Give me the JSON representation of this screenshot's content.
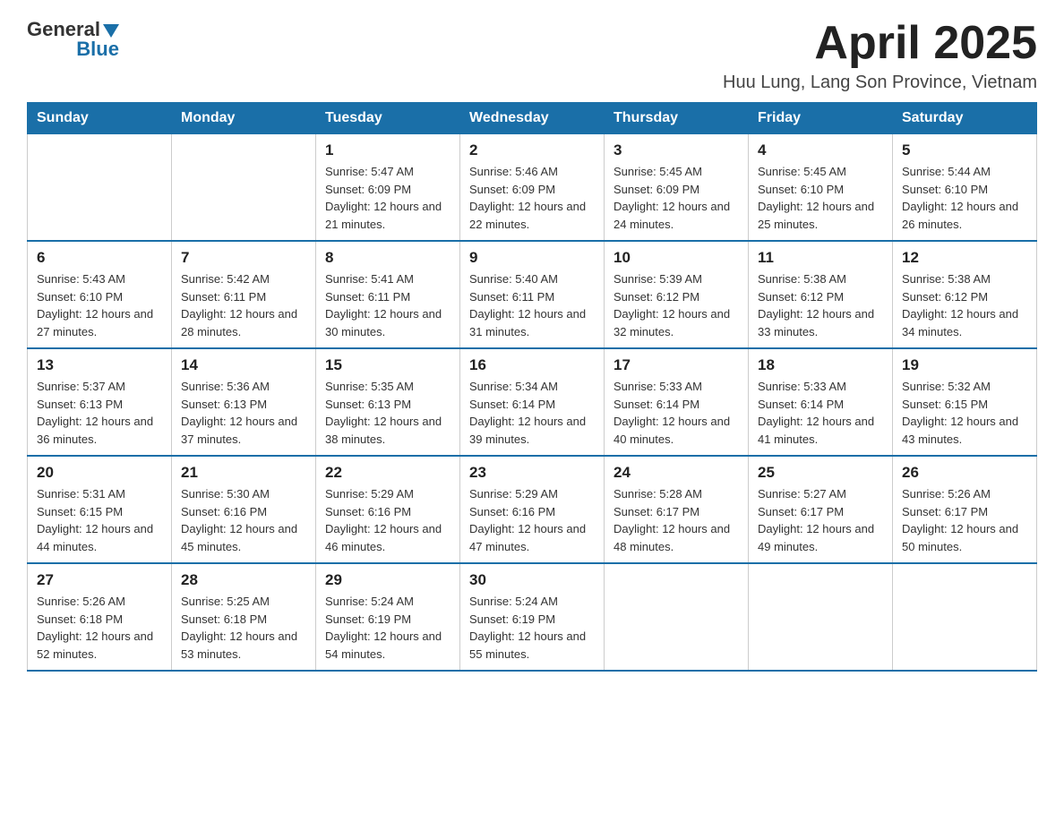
{
  "logo": {
    "text_general": "General",
    "text_blue": "Blue",
    "arrow": "▼"
  },
  "header": {
    "month_title": "April 2025",
    "location": "Huu Lung, Lang Son Province, Vietnam"
  },
  "days_of_week": [
    "Sunday",
    "Monday",
    "Tuesday",
    "Wednesday",
    "Thursday",
    "Friday",
    "Saturday"
  ],
  "weeks": [
    [
      {
        "day": "",
        "sunrise": "",
        "sunset": "",
        "daylight": ""
      },
      {
        "day": "",
        "sunrise": "",
        "sunset": "",
        "daylight": ""
      },
      {
        "day": "1",
        "sunrise": "Sunrise: 5:47 AM",
        "sunset": "Sunset: 6:09 PM",
        "daylight": "Daylight: 12 hours and 21 minutes."
      },
      {
        "day": "2",
        "sunrise": "Sunrise: 5:46 AM",
        "sunset": "Sunset: 6:09 PM",
        "daylight": "Daylight: 12 hours and 22 minutes."
      },
      {
        "day": "3",
        "sunrise": "Sunrise: 5:45 AM",
        "sunset": "Sunset: 6:09 PM",
        "daylight": "Daylight: 12 hours and 24 minutes."
      },
      {
        "day": "4",
        "sunrise": "Sunrise: 5:45 AM",
        "sunset": "Sunset: 6:10 PM",
        "daylight": "Daylight: 12 hours and 25 minutes."
      },
      {
        "day": "5",
        "sunrise": "Sunrise: 5:44 AM",
        "sunset": "Sunset: 6:10 PM",
        "daylight": "Daylight: 12 hours and 26 minutes."
      }
    ],
    [
      {
        "day": "6",
        "sunrise": "Sunrise: 5:43 AM",
        "sunset": "Sunset: 6:10 PM",
        "daylight": "Daylight: 12 hours and 27 minutes."
      },
      {
        "day": "7",
        "sunrise": "Sunrise: 5:42 AM",
        "sunset": "Sunset: 6:11 PM",
        "daylight": "Daylight: 12 hours and 28 minutes."
      },
      {
        "day": "8",
        "sunrise": "Sunrise: 5:41 AM",
        "sunset": "Sunset: 6:11 PM",
        "daylight": "Daylight: 12 hours and 30 minutes."
      },
      {
        "day": "9",
        "sunrise": "Sunrise: 5:40 AM",
        "sunset": "Sunset: 6:11 PM",
        "daylight": "Daylight: 12 hours and 31 minutes."
      },
      {
        "day": "10",
        "sunrise": "Sunrise: 5:39 AM",
        "sunset": "Sunset: 6:12 PM",
        "daylight": "Daylight: 12 hours and 32 minutes."
      },
      {
        "day": "11",
        "sunrise": "Sunrise: 5:38 AM",
        "sunset": "Sunset: 6:12 PM",
        "daylight": "Daylight: 12 hours and 33 minutes."
      },
      {
        "day": "12",
        "sunrise": "Sunrise: 5:38 AM",
        "sunset": "Sunset: 6:12 PM",
        "daylight": "Daylight: 12 hours and 34 minutes."
      }
    ],
    [
      {
        "day": "13",
        "sunrise": "Sunrise: 5:37 AM",
        "sunset": "Sunset: 6:13 PM",
        "daylight": "Daylight: 12 hours and 36 minutes."
      },
      {
        "day": "14",
        "sunrise": "Sunrise: 5:36 AM",
        "sunset": "Sunset: 6:13 PM",
        "daylight": "Daylight: 12 hours and 37 minutes."
      },
      {
        "day": "15",
        "sunrise": "Sunrise: 5:35 AM",
        "sunset": "Sunset: 6:13 PM",
        "daylight": "Daylight: 12 hours and 38 minutes."
      },
      {
        "day": "16",
        "sunrise": "Sunrise: 5:34 AM",
        "sunset": "Sunset: 6:14 PM",
        "daylight": "Daylight: 12 hours and 39 minutes."
      },
      {
        "day": "17",
        "sunrise": "Sunrise: 5:33 AM",
        "sunset": "Sunset: 6:14 PM",
        "daylight": "Daylight: 12 hours and 40 minutes."
      },
      {
        "day": "18",
        "sunrise": "Sunrise: 5:33 AM",
        "sunset": "Sunset: 6:14 PM",
        "daylight": "Daylight: 12 hours and 41 minutes."
      },
      {
        "day": "19",
        "sunrise": "Sunrise: 5:32 AM",
        "sunset": "Sunset: 6:15 PM",
        "daylight": "Daylight: 12 hours and 43 minutes."
      }
    ],
    [
      {
        "day": "20",
        "sunrise": "Sunrise: 5:31 AM",
        "sunset": "Sunset: 6:15 PM",
        "daylight": "Daylight: 12 hours and 44 minutes."
      },
      {
        "day": "21",
        "sunrise": "Sunrise: 5:30 AM",
        "sunset": "Sunset: 6:16 PM",
        "daylight": "Daylight: 12 hours and 45 minutes."
      },
      {
        "day": "22",
        "sunrise": "Sunrise: 5:29 AM",
        "sunset": "Sunset: 6:16 PM",
        "daylight": "Daylight: 12 hours and 46 minutes."
      },
      {
        "day": "23",
        "sunrise": "Sunrise: 5:29 AM",
        "sunset": "Sunset: 6:16 PM",
        "daylight": "Daylight: 12 hours and 47 minutes."
      },
      {
        "day": "24",
        "sunrise": "Sunrise: 5:28 AM",
        "sunset": "Sunset: 6:17 PM",
        "daylight": "Daylight: 12 hours and 48 minutes."
      },
      {
        "day": "25",
        "sunrise": "Sunrise: 5:27 AM",
        "sunset": "Sunset: 6:17 PM",
        "daylight": "Daylight: 12 hours and 49 minutes."
      },
      {
        "day": "26",
        "sunrise": "Sunrise: 5:26 AM",
        "sunset": "Sunset: 6:17 PM",
        "daylight": "Daylight: 12 hours and 50 minutes."
      }
    ],
    [
      {
        "day": "27",
        "sunrise": "Sunrise: 5:26 AM",
        "sunset": "Sunset: 6:18 PM",
        "daylight": "Daylight: 12 hours and 52 minutes."
      },
      {
        "day": "28",
        "sunrise": "Sunrise: 5:25 AM",
        "sunset": "Sunset: 6:18 PM",
        "daylight": "Daylight: 12 hours and 53 minutes."
      },
      {
        "day": "29",
        "sunrise": "Sunrise: 5:24 AM",
        "sunset": "Sunset: 6:19 PM",
        "daylight": "Daylight: 12 hours and 54 minutes."
      },
      {
        "day": "30",
        "sunrise": "Sunrise: 5:24 AM",
        "sunset": "Sunset: 6:19 PM",
        "daylight": "Daylight: 12 hours and 55 minutes."
      },
      {
        "day": "",
        "sunrise": "",
        "sunset": "",
        "daylight": ""
      },
      {
        "day": "",
        "sunrise": "",
        "sunset": "",
        "daylight": ""
      },
      {
        "day": "",
        "sunrise": "",
        "sunset": "",
        "daylight": ""
      }
    ]
  ]
}
